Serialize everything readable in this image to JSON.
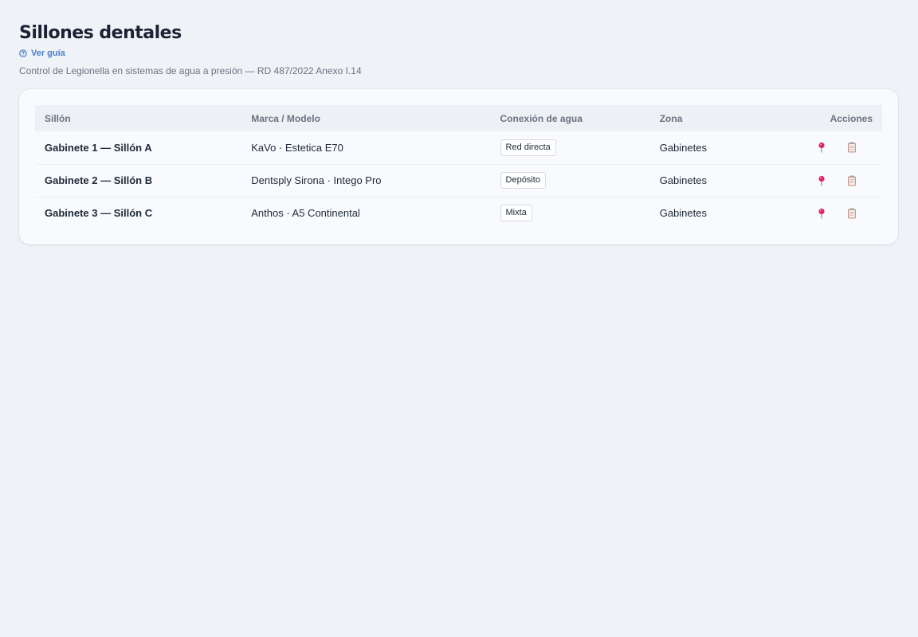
{
  "page": {
    "title": "Sillones dentales",
    "guide_link": "Ver guía",
    "subtitle": "Control de Legionella en sistemas de agua a presión — RD 487/2022 Anexo I.14"
  },
  "table": {
    "headers": {
      "chair": "Sillón",
      "model": "Marca / Modelo",
      "water": "Conexión de agua",
      "zone": "Zona",
      "actions": "Acciones"
    },
    "rows": [
      {
        "chair": "Gabinete 1 — Sillón A",
        "model": "KaVo · Estetica E70",
        "water": "Red directa",
        "zone": "Gabinetes"
      },
      {
        "chair": "Gabinete 2 — Sillón B",
        "model": "Dentsply Sirona · Intego Pro",
        "water": "Depósito",
        "zone": "Gabinetes"
      },
      {
        "chair": "Gabinete 3 — Sillón C",
        "model": "Anthos · A5 Continental",
        "water": "Mixta",
        "zone": "Gabinetes"
      }
    ],
    "row_actions": [
      "pushpin-icon",
      "clipboard-icon"
    ]
  },
  "colors": {
    "background": "#eff2f7",
    "link": "#4f7fc4",
    "pin": "#e0245e"
  }
}
